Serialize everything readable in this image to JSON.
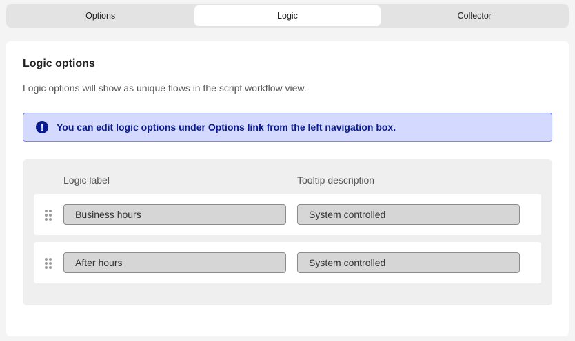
{
  "tabs": [
    {
      "label": "Options",
      "active": false
    },
    {
      "label": "Logic",
      "active": true
    },
    {
      "label": "Collector",
      "active": false
    }
  ],
  "panel": {
    "title": "Logic options",
    "description": "Logic options will show as unique flows in the script workflow view.",
    "alert": {
      "icon": "exclamation-circle-icon",
      "text": "You can edit logic options under Options link from the left navigation box."
    },
    "columns": {
      "label": "Logic label",
      "tooltip": "Tooltip description"
    },
    "rows": [
      {
        "label": "Business hours",
        "tooltip": "System controlled"
      },
      {
        "label": "After hours",
        "tooltip": "System controlled"
      }
    ]
  },
  "colors": {
    "alert_bg": "#d3d9ff",
    "alert_text": "#0a1a8a"
  }
}
